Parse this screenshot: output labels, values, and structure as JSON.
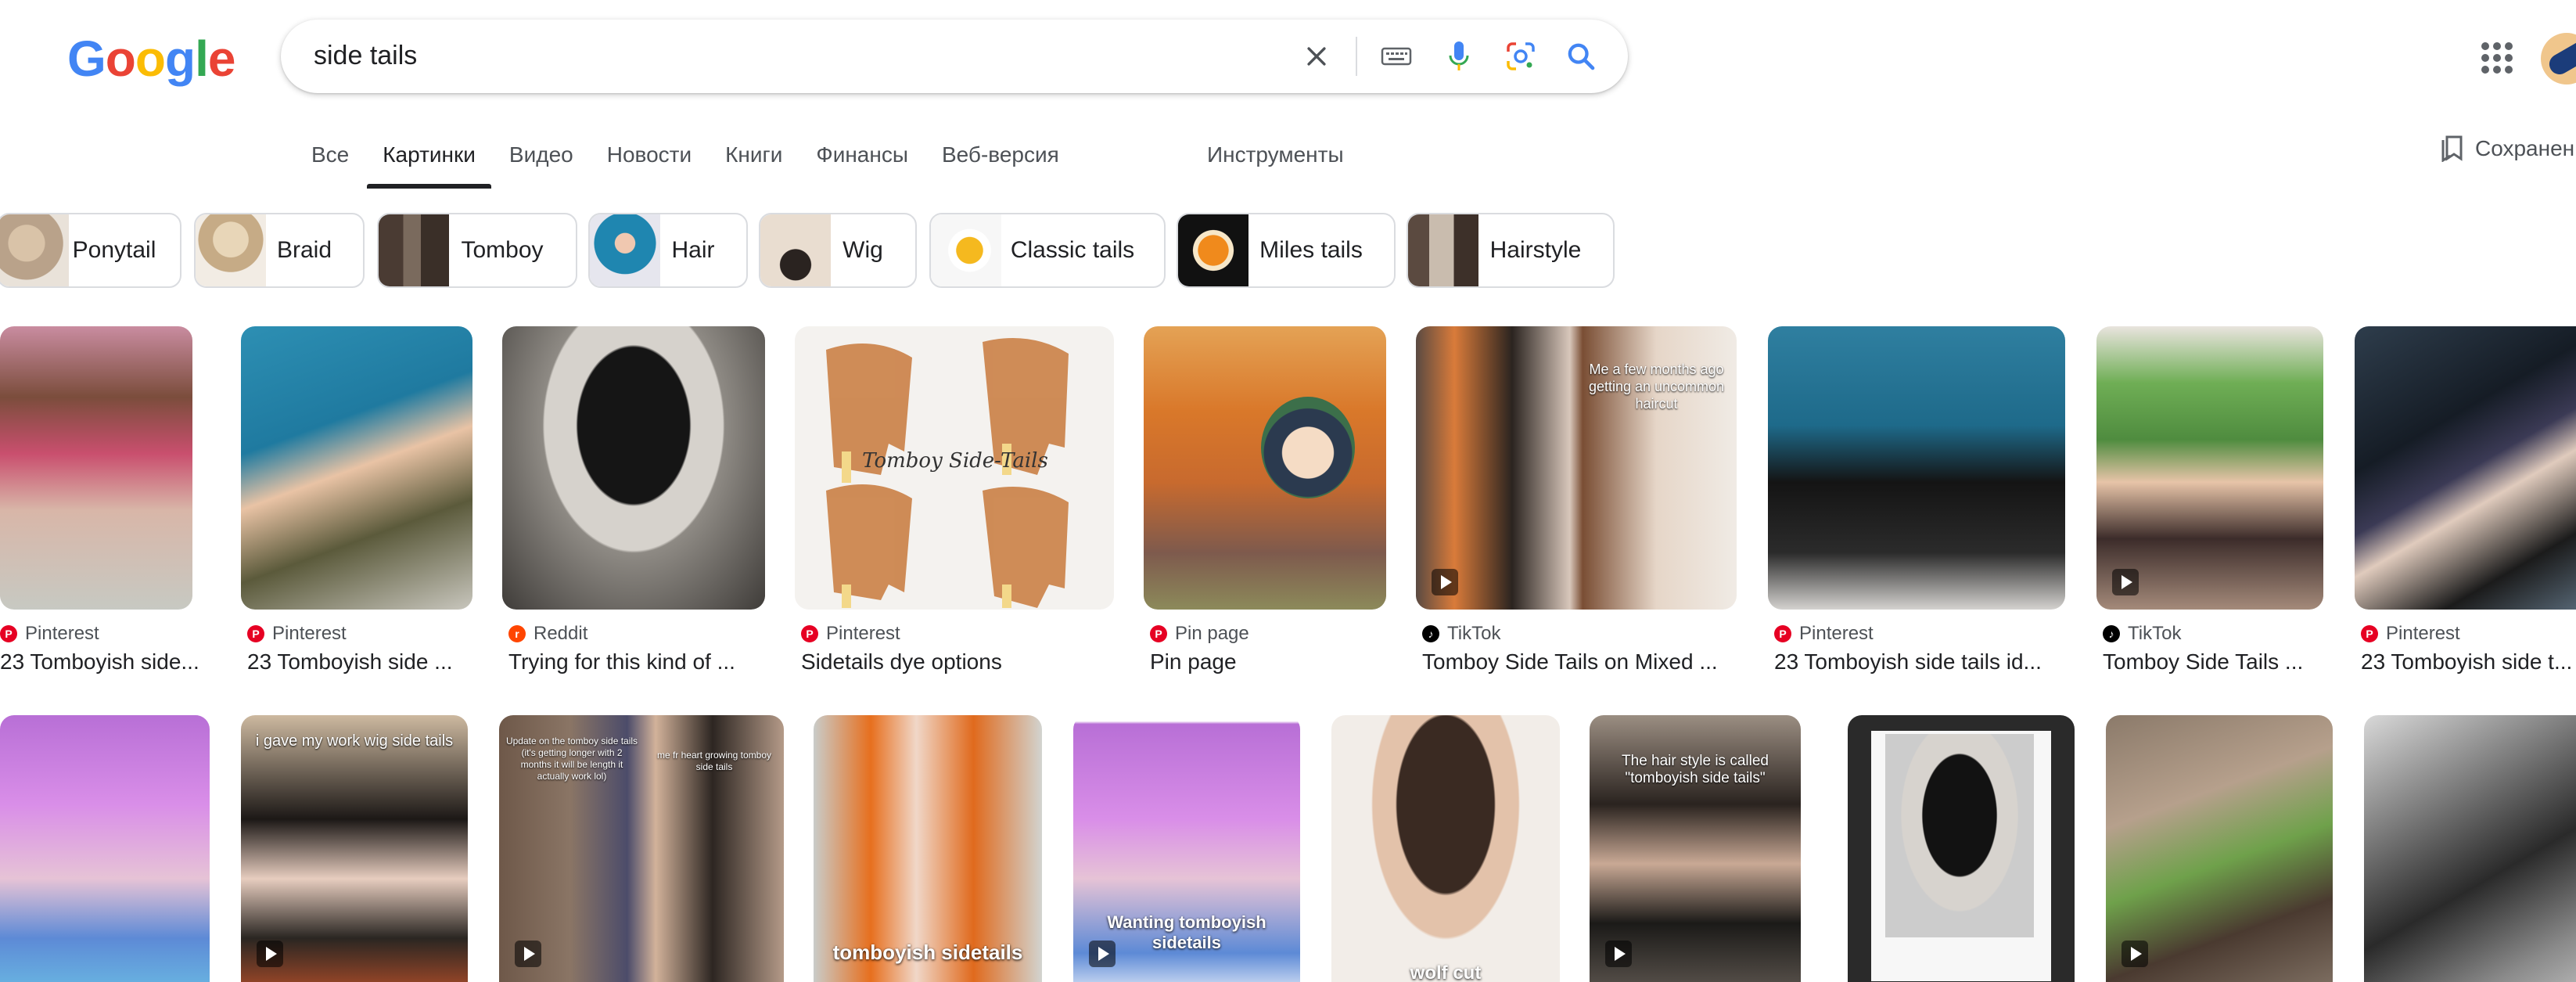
{
  "header": {
    "logo_letters": [
      "G",
      "o",
      "o",
      "g",
      "l",
      "e"
    ],
    "logo_colors": [
      "#4285F4",
      "#EA4335",
      "#FBBC05",
      "#4285F4",
      "#34A853",
      "#EA4335"
    ],
    "search_value": "side tails",
    "icons": [
      "clear-icon",
      "keyboard-icon",
      "microphone-icon",
      "lens-icon",
      "search-icon"
    ],
    "apps_icon": "apps-grid-icon",
    "avatar_icon": "account-avatar"
  },
  "tabs": [
    {
      "label": "Все",
      "active": false
    },
    {
      "label": "Картинки",
      "active": true
    },
    {
      "label": "Видео",
      "active": false
    },
    {
      "label": "Новости",
      "active": false
    },
    {
      "label": "Книги",
      "active": false
    },
    {
      "label": "Финансы",
      "active": false
    },
    {
      "label": "Веб-версия",
      "active": false
    }
  ],
  "tools_label": "Инструменты",
  "saved_label": "Сохранен",
  "chips": [
    {
      "label": "Ponytail"
    },
    {
      "label": "Braid"
    },
    {
      "label": "Tomboy"
    },
    {
      "label": "Hair"
    },
    {
      "label": "Wig"
    },
    {
      "label": "Classic tails"
    },
    {
      "label": "Miles tails"
    },
    {
      "label": "Hairstyle"
    }
  ],
  "results_row1": [
    {
      "source": "Pinterest",
      "title": "23 Tomboyish side..."
    },
    {
      "source": "Pinterest",
      "title": "23 Tomboyish side ..."
    },
    {
      "source": "Reddit",
      "title": "Trying for this kind of ..."
    },
    {
      "source": "Pinterest",
      "title": "Sidetails dye options"
    },
    {
      "source": "Pin page",
      "title": "Pin page"
    },
    {
      "source": "TikTok",
      "title": "Tomboy Side Tails on Mixed ..."
    },
    {
      "source": "Pinterest",
      "title": "23 Tomboyish side tails id..."
    },
    {
      "source": "TikTok",
      "title": "Tomboy Side Tails ..."
    },
    {
      "source": "Pinterest",
      "title": "23 Tomboyish side t..."
    }
  ],
  "row1_image_text": {
    "drawing_text": "Tomboy Side-Tails",
    "tiktok_caption": "Me a few months ago getting an uncommon haircut"
  },
  "row2_image_text": {
    "c2": "i gave my work wig side tails",
    "c3a": "Update on the tomboy side tails (it's getting longer with 2 months it will be length it actually work lol)",
    "c3b": "me fr heart growing tomboy side tails",
    "c4": "tomboyish sidetails",
    "c5": "Wanting tomboyish sidetails",
    "c6": "wolf cut",
    "c7": "The hair style is called \"tomboyish side tails\""
  },
  "source_colors": {
    "Pinterest": "#E60023",
    "Reddit": "#FF4500",
    "TikTok": "#000000",
    "Pin page": "#E60023"
  }
}
